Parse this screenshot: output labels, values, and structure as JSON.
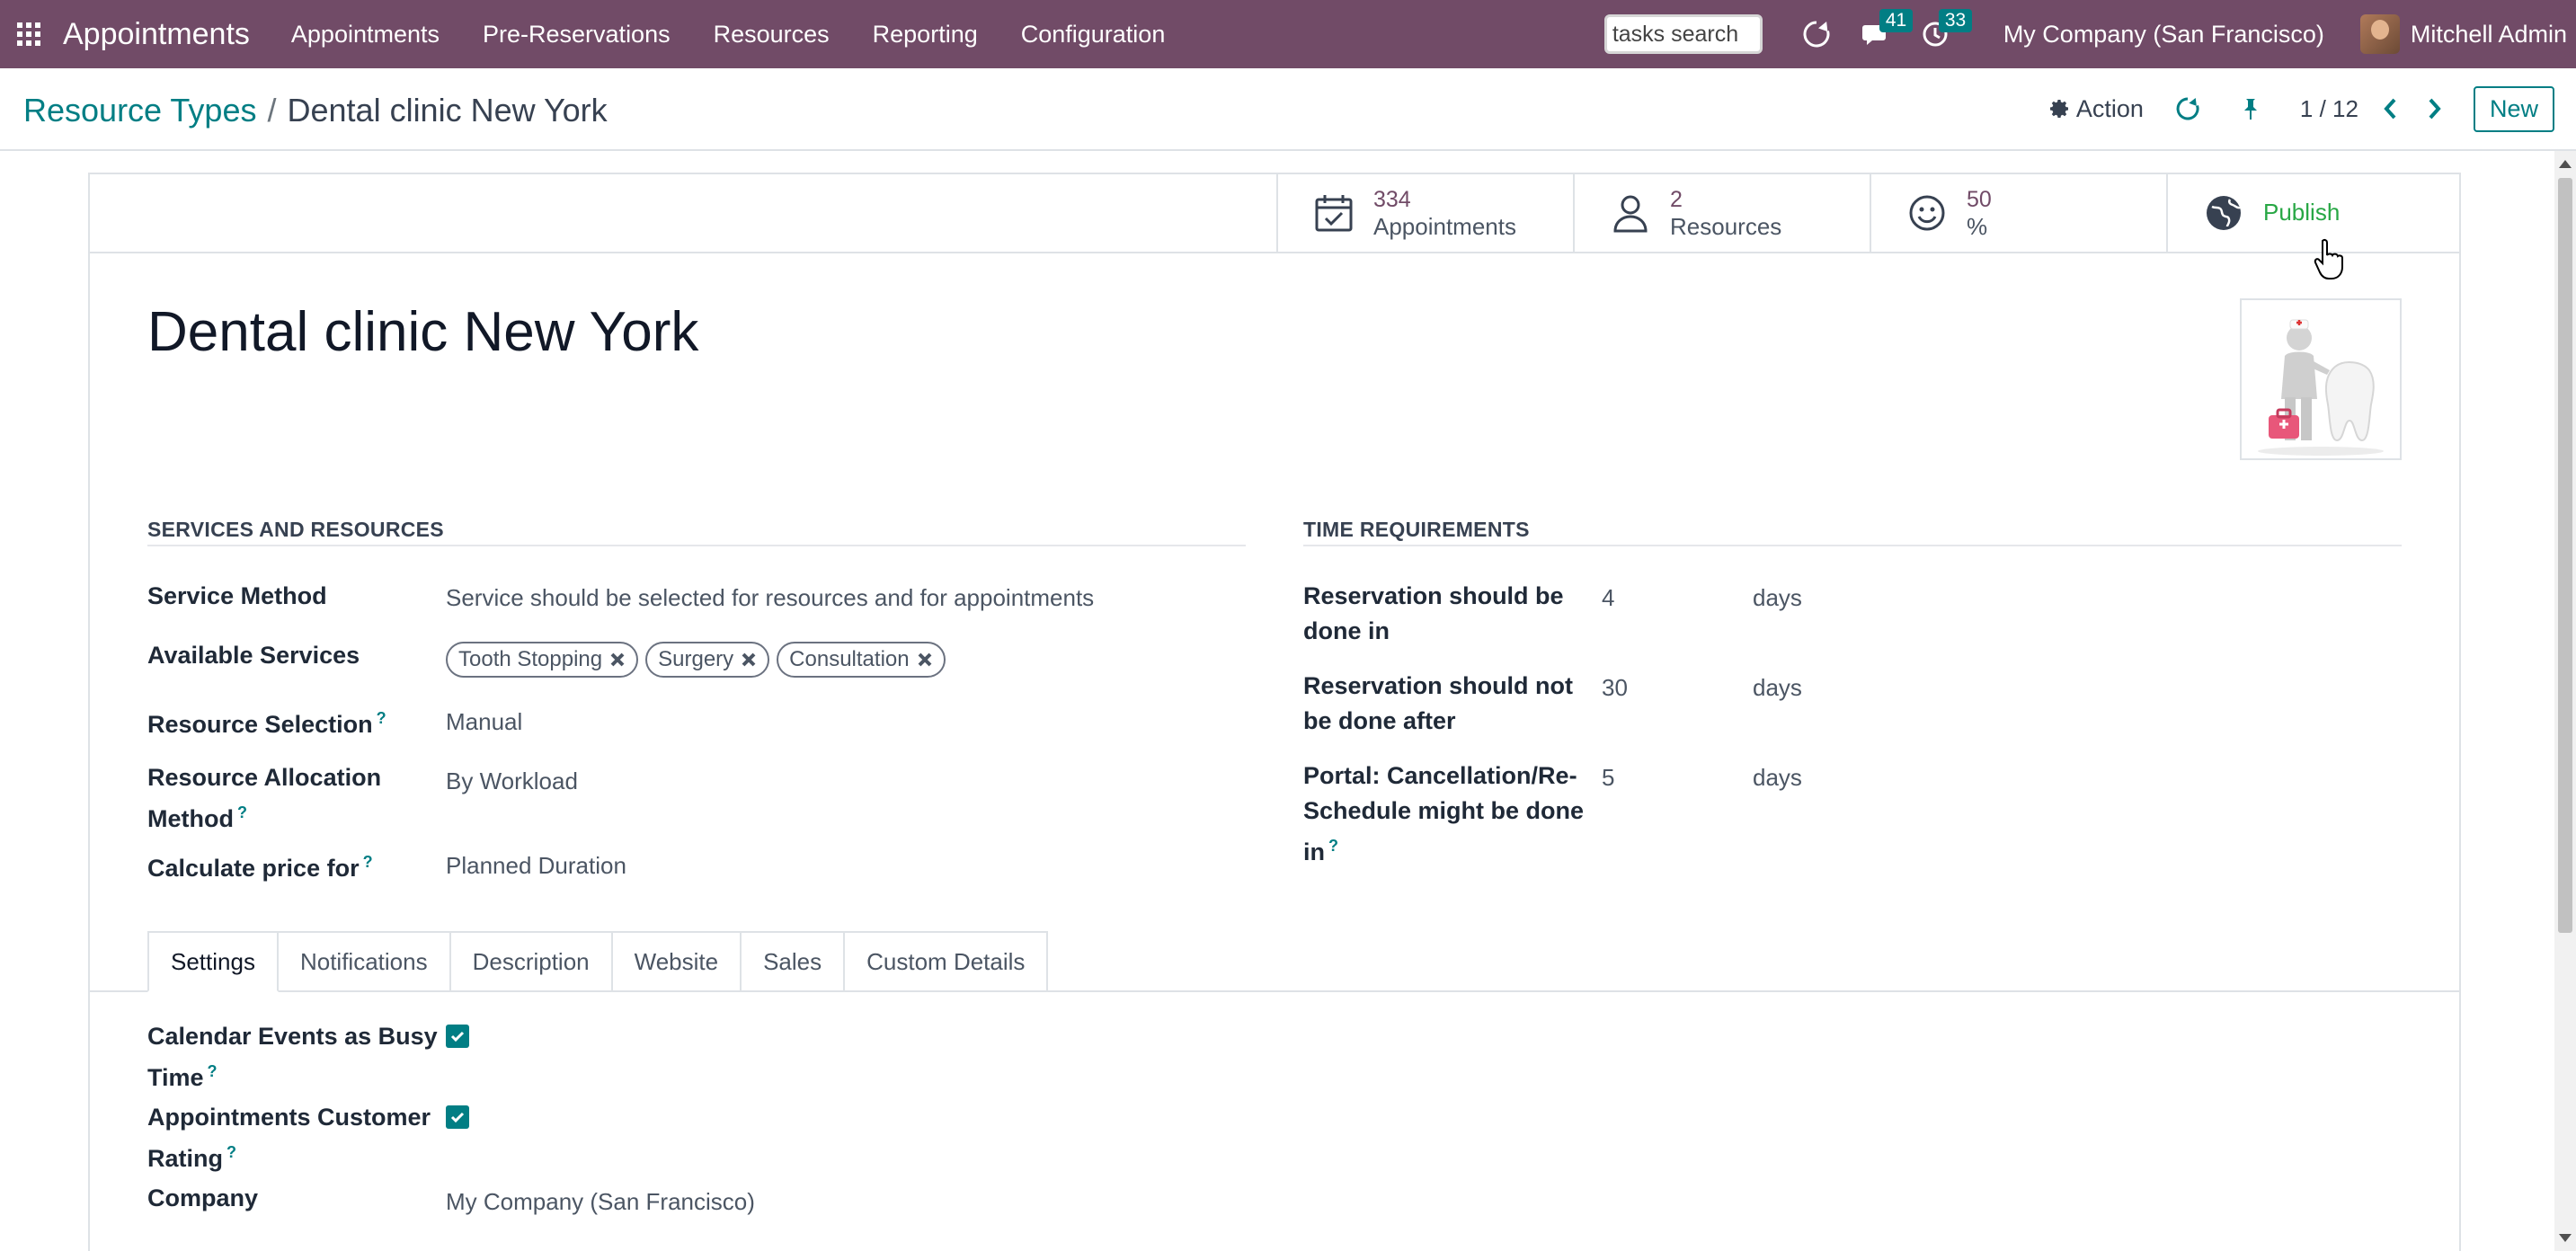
{
  "navbar": {
    "brand": "Appointments",
    "menu": [
      "Appointments",
      "Pre-Reservations",
      "Resources",
      "Reporting",
      "Configuration"
    ],
    "search_placeholder": "tasks search",
    "messages_badge": "41",
    "activities_badge": "33",
    "company": "My Company (San Francisco)",
    "user": "Mitchell Admin"
  },
  "control": {
    "breadcrumb_parent": "Resource Types",
    "breadcrumb_separator": "/",
    "breadcrumb_current": "Dental clinic New York",
    "action_label": "Action",
    "pager": "1 / 12",
    "new_label": "New"
  },
  "stats": {
    "appointments": {
      "value": "334",
      "label": "Appointments"
    },
    "resources": {
      "value": "2",
      "label": "Resources"
    },
    "rating": {
      "value": "50",
      "label": "%"
    },
    "publish": {
      "label": "Publish"
    }
  },
  "record": {
    "title": "Dental clinic New York"
  },
  "services_section": {
    "title": "SERVICES AND RESOURCES",
    "service_method_label": "Service Method",
    "service_method_value": "Service should be selected for resources and for appointments",
    "available_services_label": "Available Services",
    "available_services": [
      "Tooth Stopping",
      "Surgery",
      "Consultation"
    ],
    "resource_selection_label": "Resource Selection",
    "resource_selection_value": "Manual",
    "allocation_label_line1": "Resource Allocation",
    "allocation_label_line2": "Method",
    "allocation_value": "By Workload",
    "price_label": "Calculate price for",
    "price_value": "Planned Duration",
    "help_mark": "?"
  },
  "time_section": {
    "title": "TIME REQUIREMENTS",
    "done_in_label_1": "Reservation should be",
    "done_in_label_2": "done in",
    "done_in_value": "4",
    "done_in_unit": "days",
    "not_after_label_1": "Reservation should not",
    "not_after_label_2": "be done after",
    "not_after_value": "30",
    "not_after_unit": "days",
    "portal_label_1": "Portal: Cancellation/Re-",
    "portal_label_2": "Schedule might be done",
    "portal_label_3": "in",
    "portal_value": "5",
    "portal_unit": "days"
  },
  "tabs": [
    "Settings",
    "Notifications",
    "Description",
    "Website",
    "Sales",
    "Custom Details"
  ],
  "settings_tab": {
    "busy_label_1": "Calendar Events as Busy",
    "busy_label_2": "Time",
    "busy_checked": true,
    "rating_label_1": "Appointments Customer",
    "rating_label_2": "Rating",
    "rating_checked": true,
    "company_label": "Company",
    "company_value": "My Company (San Francisco)"
  },
  "colors": {
    "navbar": "#714b67",
    "accent": "#017e84",
    "publish": "#28a745"
  }
}
